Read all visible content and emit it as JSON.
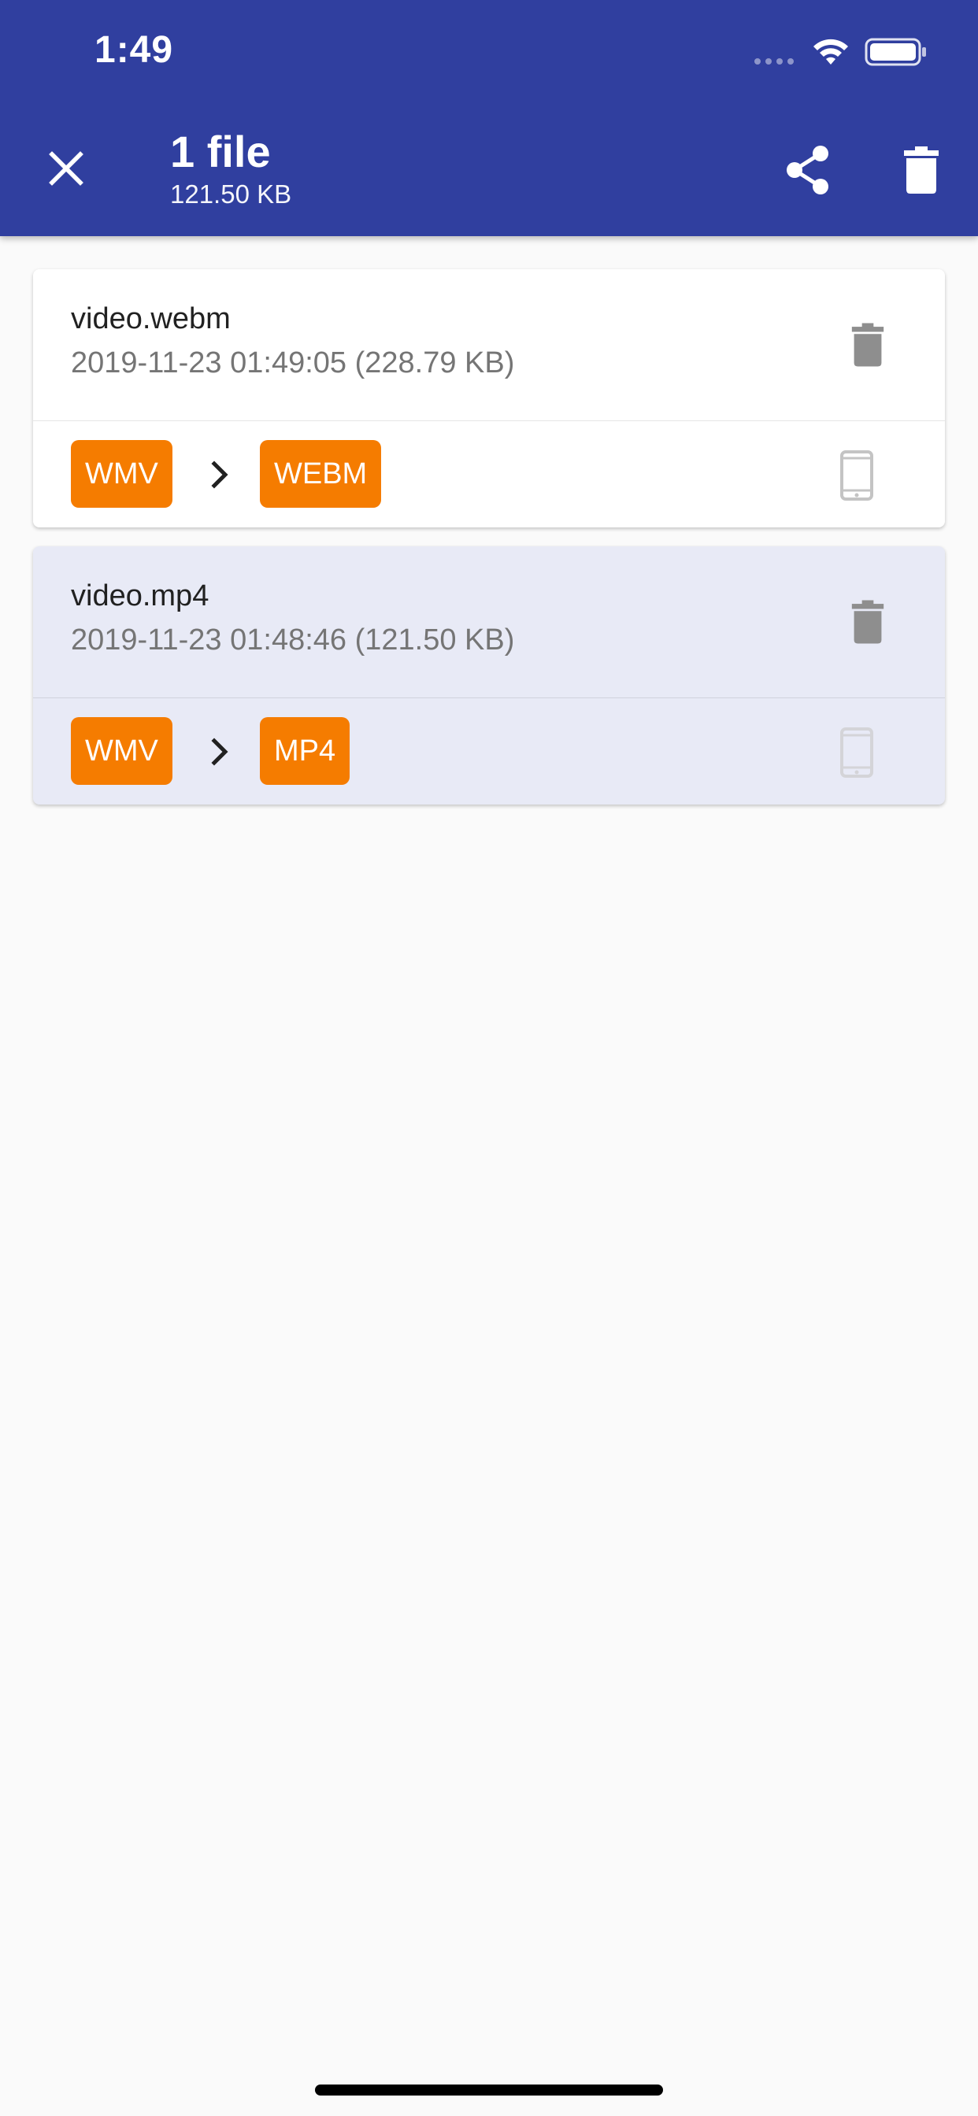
{
  "status_bar": {
    "time": "1:49"
  },
  "header": {
    "title": "1 file",
    "subtitle": "121.50 KB",
    "close_icon": "close-icon",
    "share_icon": "share-icon",
    "delete_icon": "trash-icon"
  },
  "files": [
    {
      "name": "video.webm",
      "meta": "2019-11-23 01:49:05 (228.79 KB)",
      "from_format": "WMV",
      "to_format": "WEBM",
      "selected": false
    },
    {
      "name": "video.mp4",
      "meta": "2019-11-23 01:48:46 (121.50 KB)",
      "from_format": "WMV",
      "to_format": "MP4",
      "selected": true
    }
  ],
  "colors": {
    "app_bar": "#303f9f",
    "badge": "#f57c00",
    "selected_row": "#e8eaf6",
    "background": "#fafafa"
  }
}
